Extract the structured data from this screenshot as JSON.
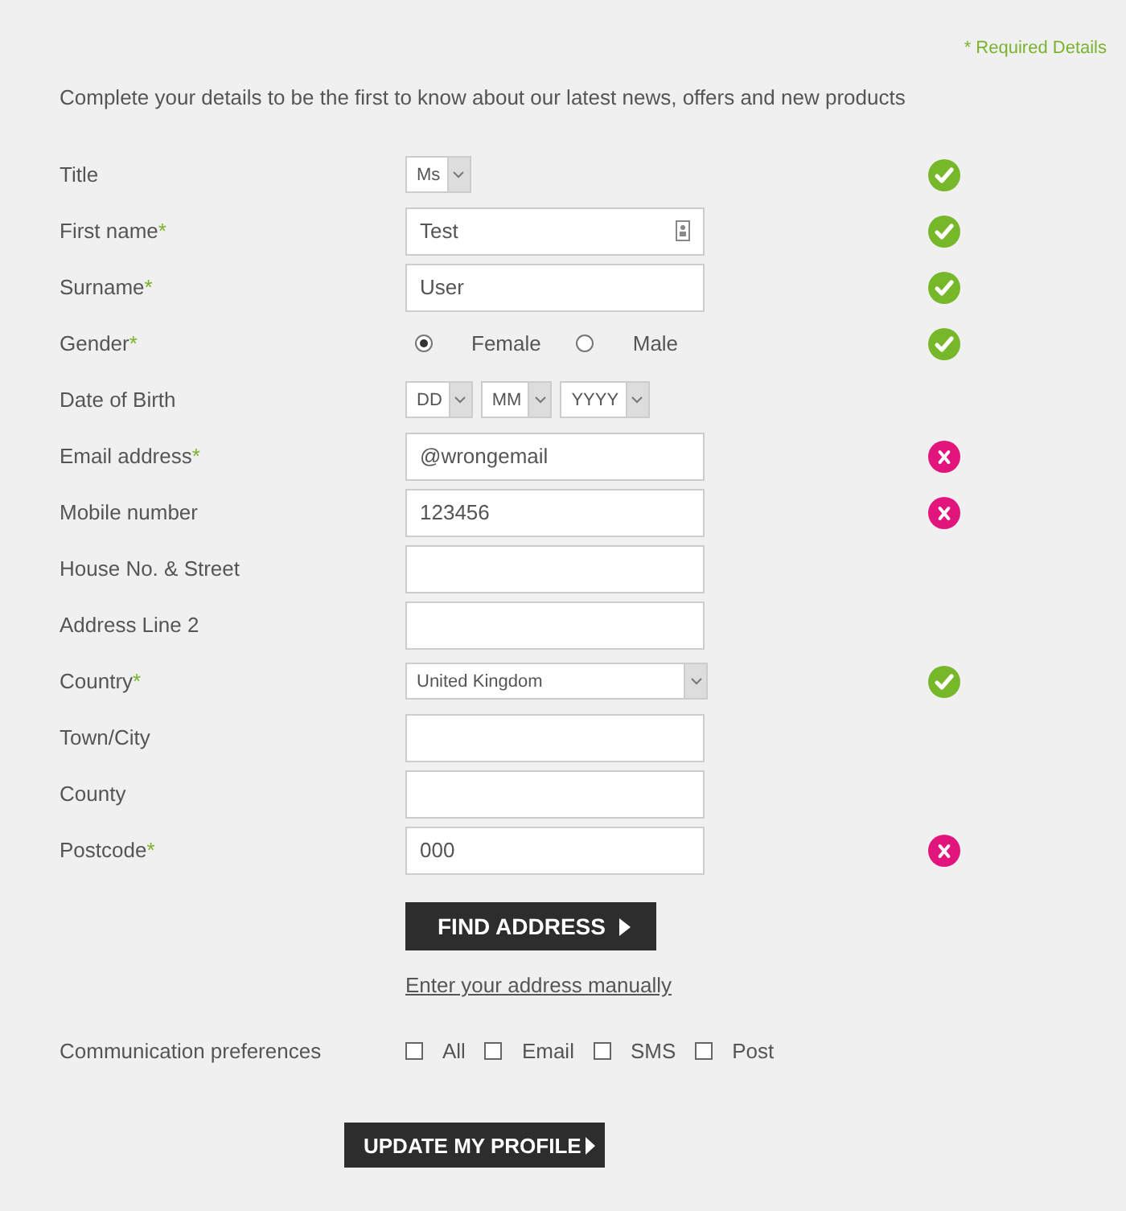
{
  "legend": {
    "mark": "*",
    "text": "Required Details"
  },
  "intro": "Complete your details to be the first to know about our latest news, offers and new products",
  "required_mark": "*",
  "rows": [
    {
      "kind": "select",
      "label": "Title",
      "required": false,
      "value": "Ms",
      "valid": true
    },
    {
      "kind": "text",
      "label": "First name",
      "required": true,
      "value": "Test",
      "card_icon": true,
      "valid": true
    },
    {
      "kind": "text",
      "label": "Surname",
      "required": true,
      "value": "User",
      "valid": true
    },
    {
      "kind": "radio",
      "label": "Gender",
      "required": true,
      "options": [
        {
          "label": "Female",
          "selected": true
        },
        {
          "label": "Male",
          "selected": false
        }
      ],
      "valid": true
    },
    {
      "kind": "date",
      "label": "Date of Birth",
      "required": false,
      "parts": [
        "DD",
        "MM",
        "YYYY"
      ]
    },
    {
      "kind": "text",
      "label": "Email address",
      "required": true,
      "value": "@wrongemail",
      "valid": false
    },
    {
      "kind": "text",
      "label": "Mobile number",
      "required": false,
      "value": "123456",
      "valid": false
    },
    {
      "kind": "text",
      "label": "House No. & Street",
      "required": false
    },
    {
      "kind": "text",
      "label": "Address Line 2",
      "required": false
    },
    {
      "kind": "wide_select",
      "label": "Country",
      "required": true,
      "value": "United Kingdom",
      "valid": true
    },
    {
      "kind": "text",
      "label": "Town/City",
      "required": false
    },
    {
      "kind": "text",
      "label": "County",
      "required": false
    },
    {
      "kind": "text",
      "label": "Postcode",
      "required": true,
      "value": "000",
      "valid": false
    }
  ],
  "find_button": "FIND ADDRESS",
  "manual_link": "Enter your address manually",
  "preferences": {
    "label": "Communication preferences",
    "options": [
      {
        "label": "All",
        "checked": false
      },
      {
        "label": "Email",
        "checked": false
      },
      {
        "label": "SMS",
        "checked": false
      },
      {
        "label": "Post",
        "checked": false
      }
    ]
  },
  "submit_button": "UPDATE MY PROFILE"
}
